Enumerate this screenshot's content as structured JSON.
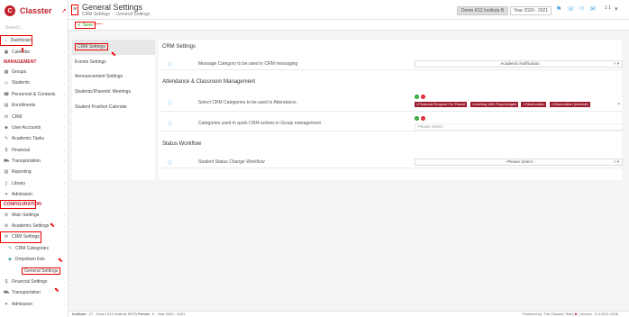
{
  "app": {
    "brand": "Classter",
    "brand_mark": "C"
  },
  "sidebar": {
    "search_placeholder": "Search...",
    "dashboard": "Dashboard",
    "calendar": "Calendar",
    "management_title": "MANAGEMENT",
    "management_items": [
      {
        "label": "Groups",
        "icon": "groups-icon",
        "glyph": "▦"
      },
      {
        "label": "Students",
        "icon": "students-icon",
        "glyph": "☺"
      },
      {
        "label": "Personnel & Contacts",
        "icon": "contacts-icon",
        "glyph": "☎"
      },
      {
        "label": "Enrollments",
        "icon": "enrollments-icon",
        "glyph": "▤"
      },
      {
        "label": "CRM",
        "icon": "crm-icon",
        "glyph": "✉"
      },
      {
        "label": "User Accounts",
        "icon": "user-accounts-icon",
        "glyph": "☻"
      },
      {
        "label": "Academic Tasks",
        "icon": "tasks-icon",
        "glyph": "✎"
      },
      {
        "label": "Financial",
        "icon": "financial-icon",
        "glyph": "$"
      },
      {
        "label": "Transportation",
        "icon": "bus-icon",
        "glyph": "⛟"
      },
      {
        "label": "Reporting",
        "icon": "reporting-icon",
        "glyph": "▥"
      },
      {
        "label": "Library",
        "icon": "library-icon",
        "glyph": "▯"
      },
      {
        "label": "Admission",
        "icon": "admission-icon",
        "glyph": "✦"
      }
    ],
    "configuration_title": "CONFIGURATION",
    "config_items": [
      {
        "label": "Main Settings",
        "icon": "main-settings-icon",
        "glyph": "⚙"
      },
      {
        "label": "Academic Settings",
        "icon": "academic-settings-icon",
        "glyph": "⚙"
      },
      {
        "label": "CRM Settings",
        "icon": "crm-settings-icon",
        "glyph": "✉"
      }
    ],
    "crm_subitems": [
      "CRM Categories",
      "Dropdown lists",
      "General Settings"
    ],
    "after_items": [
      {
        "label": "Financial Settings",
        "icon": "financial-settings-icon",
        "glyph": "$"
      },
      {
        "label": "Transportation",
        "icon": "transportation-settings-icon",
        "glyph": "⛟"
      },
      {
        "label": "Admission",
        "icon": "admission-settings-icon",
        "glyph": "✦"
      }
    ]
  },
  "header": {
    "title": "General Settings",
    "breadcrumb": [
      "CRM Settings",
      "General Settings"
    ],
    "institute": "Demo K12 Institute B",
    "year": "Year 2020 - 2021",
    "user": "1 1"
  },
  "toolbar": {
    "save_label": "Save"
  },
  "left_panel": {
    "items": [
      "CRM Settings",
      "Events Settings",
      "Announcement Settings",
      "Students'/Parents' Meetings",
      "Student Position Calendar"
    ]
  },
  "main": {
    "crm_title": "CRM Settings",
    "message_category_label": "Message Category to be used in CRM messaging",
    "message_category_value": "Academic Notification",
    "attendance_title": "Attendance & Classroom Management",
    "select_categories_label": "Select CRM Categories to be used in Attendance.",
    "tags": [
      "Financial Request For Parent",
      "meeting With Psychologist",
      "Observation",
      "Observation (internal)"
    ],
    "group_categories_label": "Categories used in quick CRM actions in Group management",
    "please_select": "Please Select",
    "status_title": "Status Workflow",
    "status_label": "Student Status Change Workflow",
    "status_value": "--Please Select--"
  },
  "footer": {
    "institute_label": "Institute",
    "institute_value": ": 27 - Demo K12 Institute BETA",
    "period_label": "Period",
    "period_value": ": 9 - Year 2020 - 2021",
    "powered": "Powered by: The Classter Team",
    "version": "Version : 6.0.2021.4108"
  },
  "colors": {
    "brand": "#c0232c",
    "tag": "#9b1c2e",
    "accent": "#3fa0e6",
    "annotation": "#e00000"
  }
}
